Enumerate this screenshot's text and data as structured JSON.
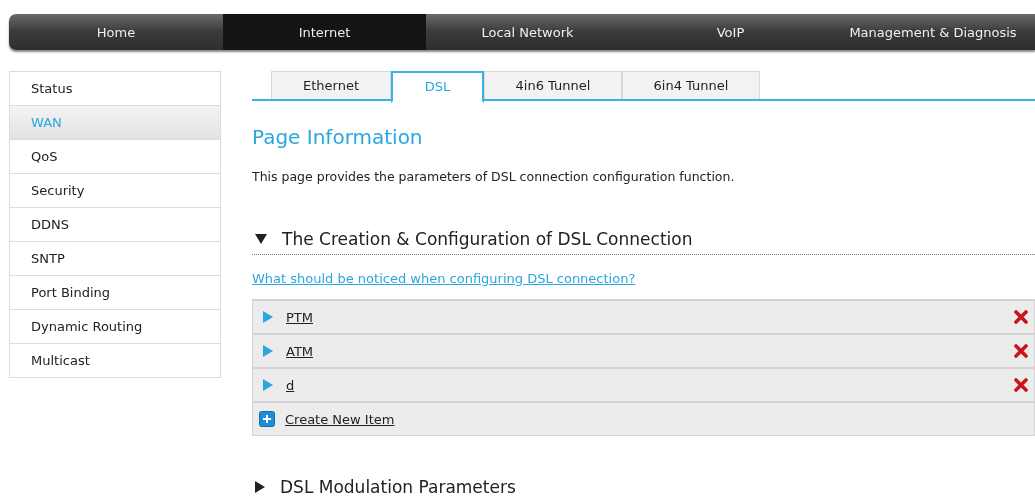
{
  "nav_tabs": [
    {
      "label": "Home",
      "selected": false
    },
    {
      "label": "Internet",
      "selected": true
    },
    {
      "label": "Local Network",
      "selected": false
    },
    {
      "label": "VoIP",
      "selected": false
    },
    {
      "label": "Management & Diagnosis",
      "selected": false
    }
  ],
  "sidebar": {
    "items": [
      {
        "label": "Status",
        "selected": false
      },
      {
        "label": "WAN",
        "selected": true
      },
      {
        "label": "QoS",
        "selected": false
      },
      {
        "label": "Security",
        "selected": false
      },
      {
        "label": "DDNS",
        "selected": false
      },
      {
        "label": "SNTP",
        "selected": false
      },
      {
        "label": "Port Binding",
        "selected": false
      },
      {
        "label": "Dynamic Routing",
        "selected": false
      },
      {
        "label": "Multicast",
        "selected": false
      }
    ]
  },
  "sub_tabs": [
    {
      "label": "Ethernet",
      "selected": false
    },
    {
      "label": "DSL",
      "selected": true
    },
    {
      "label": "4in6 Tunnel",
      "selected": false
    },
    {
      "label": "6in4 Tunnel",
      "selected": false
    }
  ],
  "page_info": {
    "title": "Page Information",
    "description": "This page provides the parameters of DSL connection configuration function."
  },
  "sections": [
    {
      "title": "The Creation & Configuration of DSL Connection",
      "expanded": true,
      "help_link": "What should be noticed when configuring DSL connection?",
      "items": [
        {
          "label": "PTM"
        },
        {
          "label": "ATM"
        },
        {
          "label": "d"
        }
      ],
      "create_label": "Create New Item"
    },
    {
      "title": "DSL Modulation Parameters",
      "expanded": false
    }
  ]
}
